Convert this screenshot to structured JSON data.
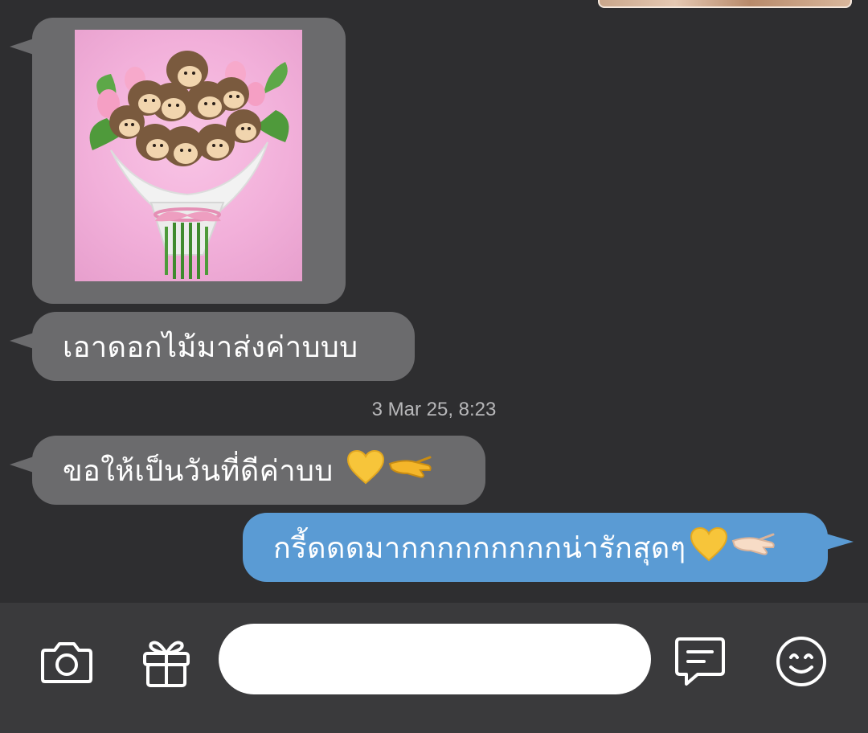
{
  "conversation": {
    "messages": [
      {
        "type": "image",
        "direction": "incoming",
        "image_desc": "hedgehog-bouquet-sticker"
      },
      {
        "type": "text",
        "direction": "incoming",
        "text": "เอาดอกไม้มาส่งค่าบบบ"
      },
      {
        "type": "text",
        "direction": "incoming",
        "text": "ขอให้เป็นวันที่ดีค่าบบ"
      },
      {
        "type": "text",
        "direction": "outgoing",
        "text": "กรี้ดดดมากกกกกกกกกน่ารักสุดๆ"
      }
    ],
    "timestamp": "3 Mar 25, 8:23"
  },
  "composer": {
    "input_value": "",
    "input_placeholder": ""
  },
  "icons": {
    "camera": "camera-icon",
    "gift": "gift-icon",
    "chat": "chat-bubble-icon",
    "emoji": "smiley-icon",
    "heart": "yellow-heart-icon",
    "hand": "pinching-hand-icon"
  },
  "colors": {
    "background": "#2e2e30",
    "incoming_bubble": "#6b6b6d",
    "outgoing_bubble": "#5a9bd4",
    "bottom_bar": "#3a3a3c"
  }
}
